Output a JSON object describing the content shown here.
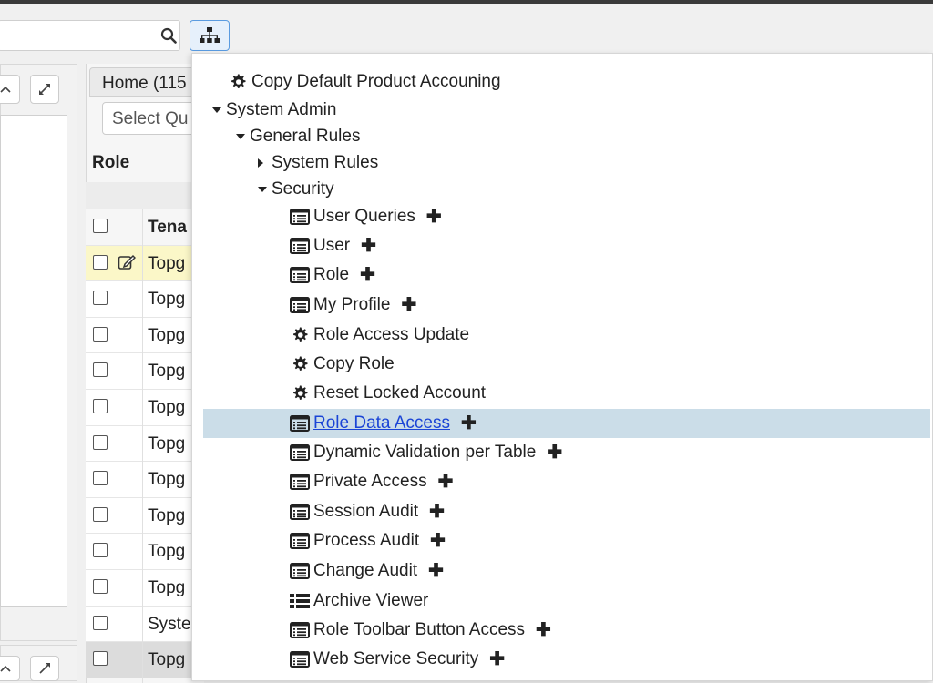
{
  "toolbar": {
    "search_icon": "search-icon",
    "tree_icon": "sitemap-icon"
  },
  "left_panel": {
    "collapse_icon": "chevron-up-icon",
    "expand_icon": "expand-arrows-icon"
  },
  "middle_panel": {
    "tab_label": "Home (115",
    "select_placeholder": "Select Qu",
    "role_label": "Role",
    "column_header": "Tena",
    "rows": [
      "Topg",
      "Topg",
      "Topg",
      "Topg",
      "Topg",
      "Topg",
      "Topg",
      "Topg",
      "Topg",
      "Topg",
      "Syste",
      "Topg"
    ]
  },
  "tree": {
    "items": [
      {
        "label": "Copy Default Product Accouning",
        "icon": "gear-icon",
        "plus": false
      },
      {
        "label": "System Admin",
        "icon": "caret-down-icon",
        "plus": false
      },
      {
        "label": "General Rules",
        "icon": "caret-down-icon",
        "plus": false
      },
      {
        "label": "System Rules",
        "icon": "caret-right-icon",
        "plus": false
      },
      {
        "label": "Security",
        "icon": "caret-down-icon",
        "plus": false
      },
      {
        "label": "User Queries",
        "icon": "list-window-icon",
        "plus": true
      },
      {
        "label": "User",
        "icon": "list-window-icon",
        "plus": true
      },
      {
        "label": "Role",
        "icon": "list-window-icon",
        "plus": true
      },
      {
        "label": "My Profile",
        "icon": "list-window-icon",
        "plus": true
      },
      {
        "label": "Role Access Update",
        "icon": "gear-icon",
        "plus": false
      },
      {
        "label": "Copy Role",
        "icon": "gear-icon",
        "plus": false
      },
      {
        "label": "Reset Locked Account",
        "icon": "gear-icon",
        "plus": false
      },
      {
        "label": "Role Data Access",
        "icon": "list-window-icon",
        "plus": true
      },
      {
        "label": "Dynamic Validation per Table",
        "icon": "list-window-icon",
        "plus": true
      },
      {
        "label": "Private Access",
        "icon": "list-window-icon",
        "plus": true
      },
      {
        "label": "Session Audit",
        "icon": "list-window-icon",
        "plus": true
      },
      {
        "label": "Process Audit",
        "icon": "list-window-icon",
        "plus": true
      },
      {
        "label": "Change Audit",
        "icon": "list-window-icon",
        "plus": true
      },
      {
        "label": "Archive Viewer",
        "icon": "list-bullets-icon",
        "plus": false
      },
      {
        "label": "Role Toolbar Button Access",
        "icon": "list-window-icon",
        "plus": true
      },
      {
        "label": "Web Service Security",
        "icon": "list-window-icon",
        "plus": true
      }
    ],
    "plus_symbol": "✚",
    "highlight_color": "#cbdde8",
    "link_color": "#1a44d6"
  }
}
